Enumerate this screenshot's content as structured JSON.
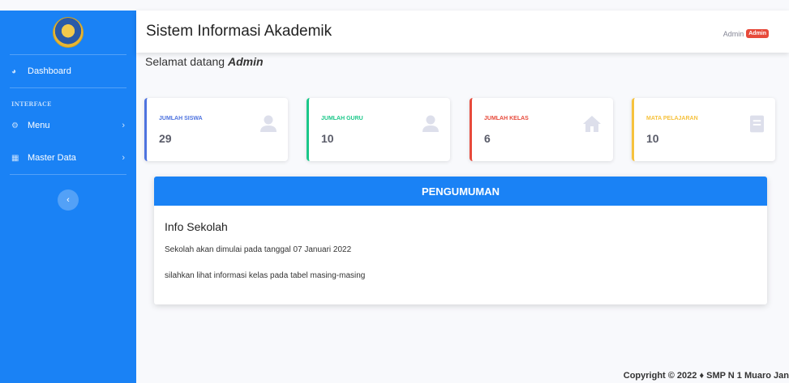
{
  "sidebar": {
    "items": [
      {
        "label": "Dashboard",
        "icon": "dashboard-icon"
      },
      {
        "label": "Menu",
        "icon": "gear-icon"
      },
      {
        "label": "Master Data",
        "icon": "table-icon"
      }
    ],
    "heading": "INTERFACE",
    "toggle_glyph": "‹"
  },
  "topbar": {
    "title": "Sistem Informasi Akademik",
    "user": "Admin",
    "badge": "Admin"
  },
  "welcome": {
    "prefix": "Selamat datang",
    "name": "Admin"
  },
  "cards": [
    {
      "label": "JUMLAH SISWA",
      "value": "29",
      "color": "#4e73df",
      "icon": "user-icon"
    },
    {
      "label": "JUMLAH GURU",
      "value": "10",
      "color": "#1cc88a",
      "icon": "user-icon"
    },
    {
      "label": "JUMLAH KELAS",
      "value": "6",
      "color": "#e74a3b",
      "icon": "home-icon"
    },
    {
      "label": "MATA PELAJARAN",
      "value": "10",
      "color": "#f6c23e",
      "icon": "book-icon"
    }
  ],
  "announcement": {
    "header": "PENGUMUMAN",
    "title": "Info Sekolah",
    "lines": [
      "Sekolah akan dimulai pada tanggal 07 Januari 2022",
      "silahkan lihat informasi kelas pada tabel masing-masing"
    ]
  },
  "footer": "Copyright © 2022 ♦ SMP N 1 Muaro Jan"
}
